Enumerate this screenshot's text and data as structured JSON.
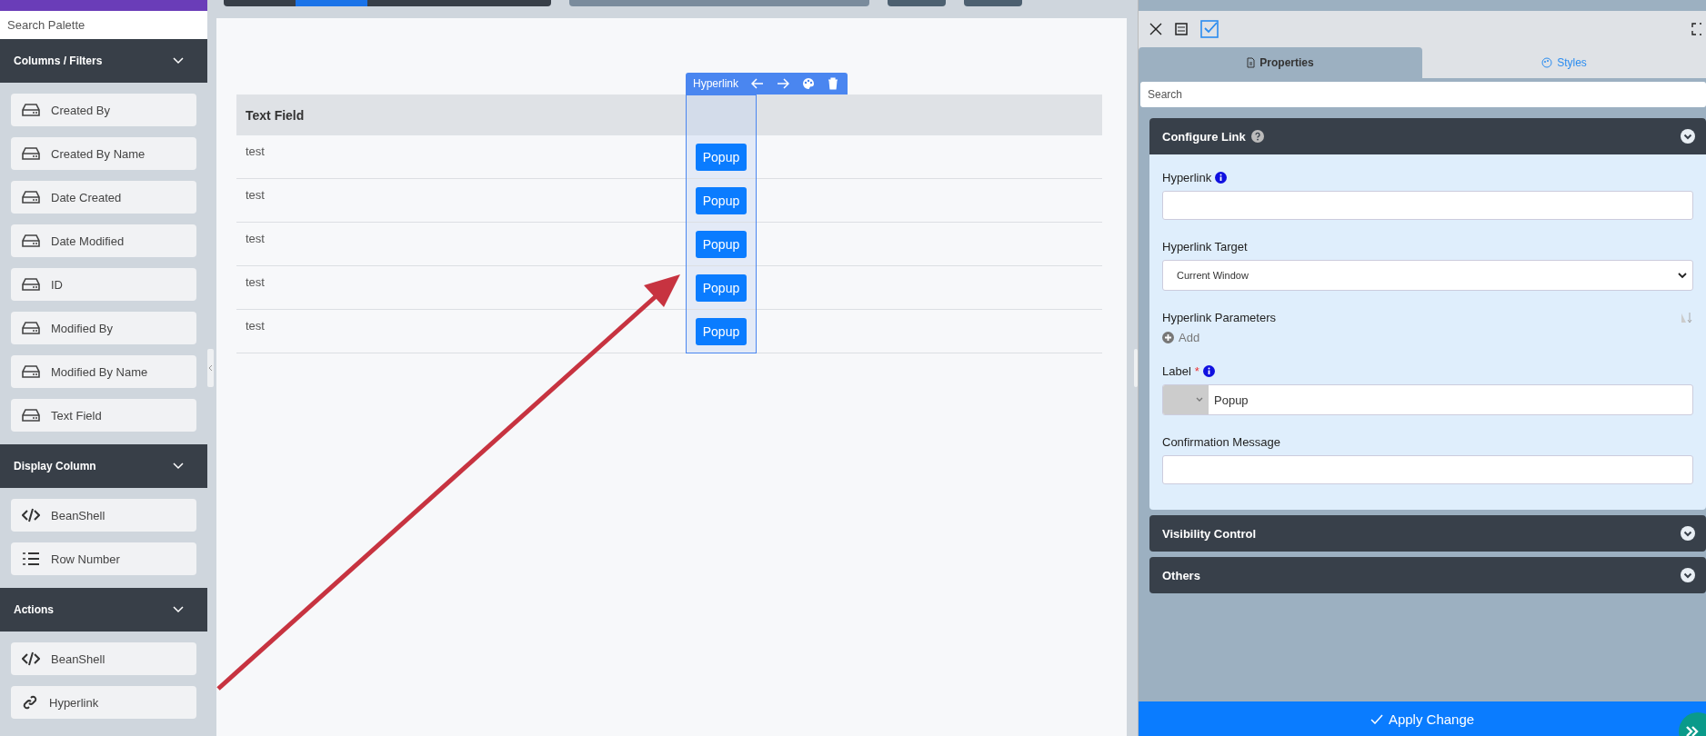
{
  "palette": {
    "search_placeholder": "Search Palette",
    "sections": [
      {
        "title": "Columns / Filters",
        "expanded": true,
        "items": [
          {
            "label": "Created By",
            "kind": "field"
          },
          {
            "label": "Created By Name",
            "kind": "field"
          },
          {
            "label": "Date Created",
            "kind": "field"
          },
          {
            "label": "Date Modified",
            "kind": "field"
          },
          {
            "label": "ID",
            "kind": "field"
          },
          {
            "label": "Modified By",
            "kind": "field"
          },
          {
            "label": "Modified By Name",
            "kind": "field"
          },
          {
            "label": "Text Field",
            "kind": "field"
          }
        ]
      },
      {
        "title": "Display Column",
        "expanded": true,
        "items": [
          {
            "label": "BeanShell",
            "kind": "code"
          },
          {
            "label": "Row Number",
            "kind": "list"
          }
        ]
      },
      {
        "title": "Actions",
        "expanded": true,
        "items": [
          {
            "label": "BeanShell",
            "kind": "code"
          },
          {
            "label": "Hyperlink",
            "kind": "link"
          }
        ]
      }
    ]
  },
  "canvas": {
    "table": {
      "columns": [
        "Text Field"
      ],
      "rows": [
        {
          "text": "test",
          "button": "Popup"
        },
        {
          "text": "test",
          "button": "Popup"
        },
        {
          "text": "test",
          "button": "Popup"
        },
        {
          "text": "test",
          "button": "Popup"
        },
        {
          "text": "test",
          "button": "Popup"
        }
      ]
    },
    "selection": {
      "label": "Hyperlink"
    }
  },
  "panel": {
    "tabs": [
      {
        "label": "Properties",
        "selected": true
      },
      {
        "label": "Styles",
        "selected": false
      }
    ],
    "search_placeholder": "Search",
    "sections": [
      {
        "title": "Configure Link",
        "help": true,
        "expanded": true,
        "fields": [
          {
            "kind": "text",
            "label": "Hyperlink",
            "info": true
          },
          {
            "kind": "select",
            "label": "Hyperlink Target",
            "value": "Current Window"
          },
          {
            "kind": "params",
            "label": "Hyperlink Parameters",
            "add": "Add"
          },
          {
            "kind": "prefixed",
            "label": "Label",
            "required_mark": "*",
            "info": true,
            "value": "Popup"
          },
          {
            "kind": "text",
            "label": "Confirmation Message"
          }
        ]
      },
      {
        "title": "Visibility Control",
        "expanded": false
      },
      {
        "title": "Others",
        "expanded": false
      }
    ],
    "apply_button": "Apply Change"
  }
}
